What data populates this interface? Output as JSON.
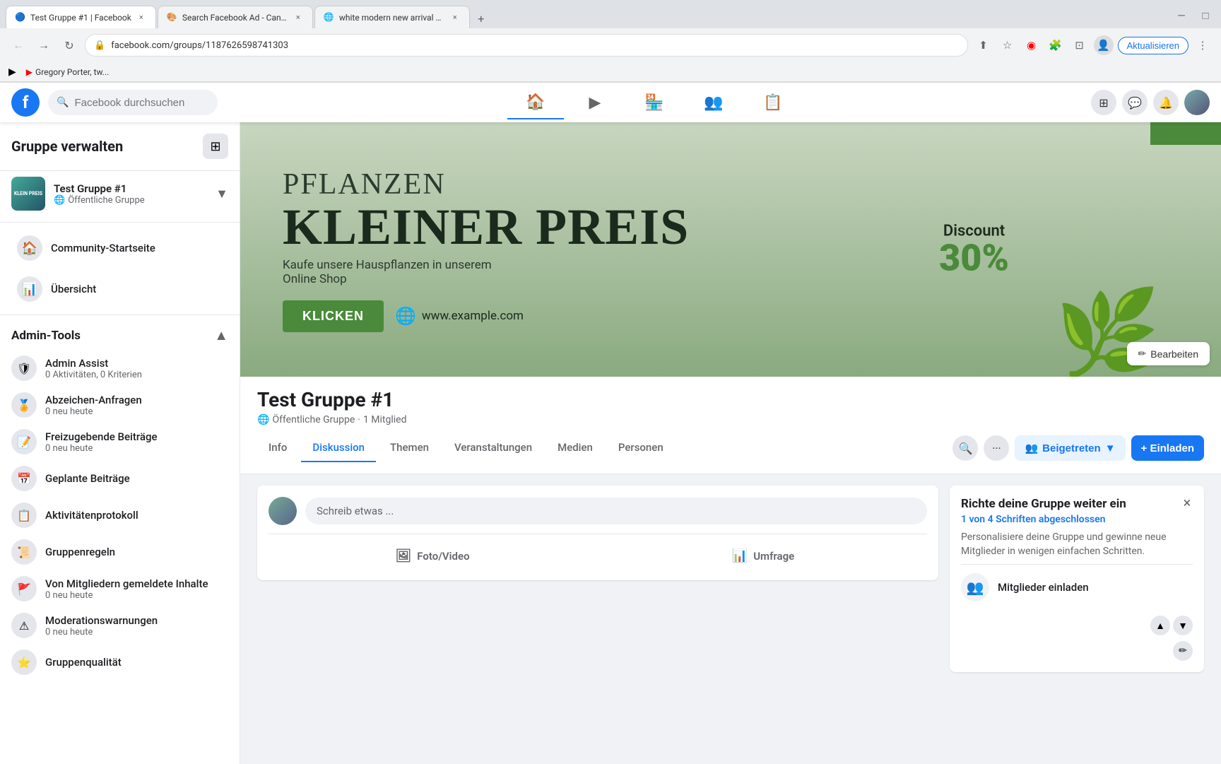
{
  "browser": {
    "tabs": [
      {
        "id": "tab1",
        "title": "Test Gruppe #1 | Facebook",
        "favicon": "🔵",
        "active": true
      },
      {
        "id": "tab2",
        "title": "Search Facebook Ad - Canva",
        "favicon": "🎨",
        "active": false
      },
      {
        "id": "tab3",
        "title": "white modern new arrival watc...",
        "favicon": "🌐",
        "active": false
      }
    ],
    "url": "facebook.com/groups/1187626598741303",
    "update_btn": "Aktualisieren",
    "bookmark": "Gregory Porter, tw..."
  },
  "header": {
    "search_placeholder": "Facebook durchsuchen",
    "nav_items": [
      {
        "icon": "🏠",
        "label": "Home",
        "active": true
      },
      {
        "icon": "▶",
        "label": "Watch",
        "active": false
      },
      {
        "icon": "🏪",
        "label": "Marketplace",
        "active": false
      },
      {
        "icon": "👥",
        "label": "Groups",
        "active": false
      },
      {
        "icon": "📋",
        "label": "Pages",
        "active": false
      }
    ]
  },
  "sidebar": {
    "title": "Gruppe verwalten",
    "group": {
      "name": "Test Gruppe #1",
      "type": "Öffentliche Gruppe"
    },
    "nav_items": [
      {
        "icon": "🏠",
        "label": "Community-Startseite"
      },
      {
        "icon": "📊",
        "label": "Übersicht"
      }
    ],
    "admin_section": "Admin-Tools",
    "admin_items": [
      {
        "icon": "🛡",
        "label": "Admin Assist",
        "sub": "0 Aktivitäten, 0 Kriterien"
      },
      {
        "icon": "🏅",
        "label": "Abzeichen-Anfragen",
        "sub": "0 neu heute"
      },
      {
        "icon": "📝",
        "label": "Freizugebende Beiträge",
        "sub": "0 neu heute"
      },
      {
        "icon": "📅",
        "label": "Geplante Beiträge",
        "sub": ""
      },
      {
        "icon": "📋",
        "label": "Aktivitätenprotokoll",
        "sub": ""
      },
      {
        "icon": "📜",
        "label": "Gruppenregeln",
        "sub": ""
      },
      {
        "icon": "🚩",
        "label": "Von Mitgliedern gemeldete Inhalte",
        "sub": "0 neu heute"
      },
      {
        "icon": "⚠",
        "label": "Moderationswarnungen",
        "sub": "0 neu heute"
      },
      {
        "icon": "⭐",
        "label": "Gruppenqualität",
        "sub": ""
      }
    ]
  },
  "cover": {
    "title_small": "PFLANZEN",
    "title_large": "KLEINER PREIS",
    "subtitle1": "Kaufe unsere Hauspflanzen in unserem",
    "subtitle2": "Online Shop",
    "discount_label": "Discount",
    "discount_value": "30%",
    "cta_button": "KLICKEN",
    "website": "www.example.com",
    "edit_button": "Bearbeiten"
  },
  "group": {
    "name": "Test Gruppe #1",
    "type": "Öffentliche Gruppe",
    "members": "1 Mitglied",
    "tabs": [
      {
        "id": "info",
        "label": "Info",
        "active": false
      },
      {
        "id": "diskussion",
        "label": "Diskussion",
        "active": true
      },
      {
        "id": "themen",
        "label": "Themen",
        "active": false
      },
      {
        "id": "veranstaltungen",
        "label": "Veranstaltungen",
        "active": false
      },
      {
        "id": "medien",
        "label": "Medien",
        "active": false
      },
      {
        "id": "personen",
        "label": "Personen",
        "active": false
      }
    ],
    "joined_btn": "Beigetreten",
    "invite_btn": "+ Einladen"
  },
  "composer": {
    "placeholder": "Schreib etwas ...",
    "actions": [
      {
        "icon": "🖼",
        "label": "Foto/Video"
      },
      {
        "icon": "📊",
        "label": "Umfrage"
      }
    ]
  },
  "setup": {
    "title": "Richte deine Gruppe weiter ein",
    "progress": "1 von 4 Schriften abgeschlossen",
    "description": "Personalisiere deine Gruppe und gewinne neue Mitglieder in wenigen einfachen Schritten.",
    "items": [
      {
        "icon": "👥",
        "label": "Mitglieder einladen"
      }
    ]
  }
}
